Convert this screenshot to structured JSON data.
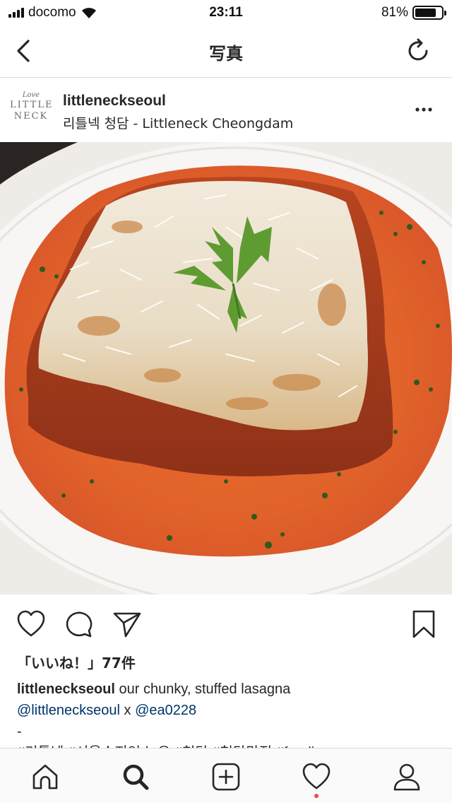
{
  "status_bar": {
    "carrier": "docomo",
    "time": "23:11",
    "battery_percent": "81%",
    "battery_level": 0.81
  },
  "nav": {
    "title": "写真",
    "back_icon": "chevron-left-icon",
    "refresh_icon": "refresh-icon"
  },
  "post": {
    "avatar_logo": {
      "line1": "Love",
      "line2": "LITTLE",
      "line3": "NECK"
    },
    "username": "littleneckseoul",
    "location": "리틀넥 청담 - Littleneck Cheongdam",
    "photo_alt": "lasagna with tomato cream sauce, parmesan and chervil",
    "likes": "「いいね！」77件",
    "caption": {
      "username": "littleneckseoul",
      "text": " our chunky, stuffed lasagna",
      "mention1": "@littleneckseoul",
      "separator": " x ",
      "mention2": "@ea0228",
      "line3": "-",
      "line4_cut": "#리틀넥 #서울수지인스 유 #청담 #청담맛집 #foodie"
    }
  },
  "tabs": [
    {
      "name": "home-icon"
    },
    {
      "name": "search-icon"
    },
    {
      "name": "new-post-icon"
    },
    {
      "name": "activity-heart-icon"
    },
    {
      "name": "profile-icon"
    }
  ],
  "colors": {
    "text": "#262626",
    "mention": "#003569",
    "divider": "#dbdbdb",
    "notification": "#ed4956",
    "sauce": "#e2632a"
  }
}
